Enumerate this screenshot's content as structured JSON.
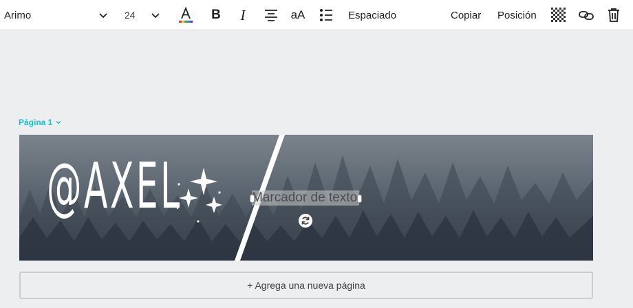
{
  "toolbar": {
    "font_family": "Arimo",
    "font_size": "24",
    "text_color_icon": "text-color-icon",
    "bold_glyph": "B",
    "italic_glyph": "I",
    "case_glyph": "aA",
    "spacing_label": "Espaciado",
    "copy_label": "Copiar",
    "position_label": "Posición"
  },
  "editor": {
    "page_label": "Página 1",
    "accent_color": "#13c4c8",
    "add_page_label": "+ Agrega una nueva página"
  },
  "canvas": {
    "logo_text": "@AXEL",
    "placeholder_text": "Marcador de texto"
  }
}
